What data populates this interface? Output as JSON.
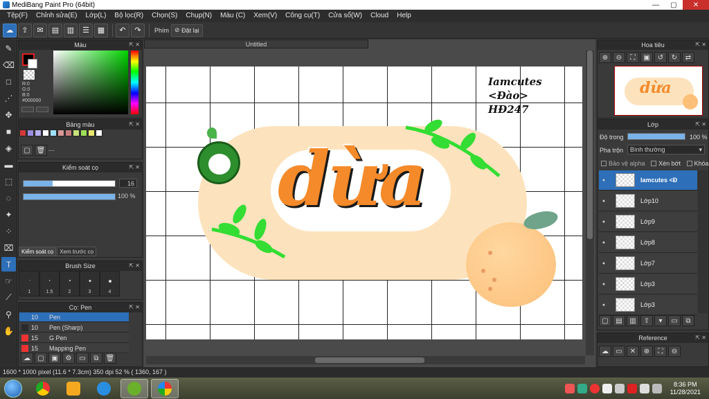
{
  "window": {
    "title": "MediBang Paint Pro (64bit)",
    "min": "—",
    "max": "▢",
    "close": "✕"
  },
  "menu": [
    "Tệp(F)",
    "Chỉnh sửa(E)",
    "Lớp(L)",
    "Bộ lọc(R)",
    "Chọn(S)",
    "Chụp(N)",
    "Màu (C)",
    "Xem(V)",
    "Công cụ(T)",
    "Cửa sổ(W)",
    "Cloud",
    "Help"
  ],
  "toolbar": {
    "shortcut_label": "Phím",
    "reset_label": "Đặt lại"
  },
  "panels": {
    "color": {
      "title": "Màu",
      "r": "R:0",
      "g": "G:0",
      "b": "B:0",
      "hex": "#000000"
    },
    "palette": {
      "title": "Bảng màu",
      "name_placeholder": "---",
      "swatches": [
        "#d23a3a",
        "#9b8ee0",
        "#b7b0f0",
        "#ffffff",
        "#a0e0ff",
        "#d89898",
        "#c67d7d",
        "#c8e27c",
        "#9ee05a",
        "#e8e870",
        "#ffffff"
      ]
    },
    "brush_control": {
      "title": "Kiểm soát cọ",
      "size_value": "16",
      "size_fraction": 0.32,
      "opacity_value": "100 %",
      "opacity_fraction": 1.0,
      "tabs": [
        "Kiểm soát cọ",
        "Xem trước cọ"
      ]
    },
    "brush_size": {
      "title": "Brush Size",
      "sizes": [
        "1",
        "1.5",
        "2",
        "3",
        "4"
      ]
    },
    "brushes": {
      "title": "Cọ: Pen",
      "items": [
        {
          "size": "10",
          "name": "Pen",
          "color": "#2d6fb8",
          "selected": true
        },
        {
          "size": "10",
          "name": "Pen (Sharp)",
          "color": "#2a2a2a",
          "selected": false
        },
        {
          "size": "15",
          "name": "G Pen",
          "color": "#e33",
          "selected": false
        },
        {
          "size": "15",
          "name": "Mapping Pen",
          "color": "#e33",
          "selected": false
        }
      ]
    },
    "navigator": {
      "title": "Hoa tiêu"
    },
    "layers": {
      "title": "Lớp",
      "opacity_label": "Độ trong",
      "opacity_value": "100 %",
      "opacity_fraction": 1.0,
      "blend_label": "Pha trộn",
      "blend_value": "Bình thường",
      "protect_alpha": "Bảo vệ alpha",
      "clipping": "Xén bớt",
      "lock": "Khóa",
      "items": [
        "Iamcutes <Đ",
        "Lớp10",
        "Lớp9",
        "Lớp8",
        "Lớp7",
        "Lớp3",
        "Lớp3"
      ]
    },
    "reference": {
      "title": "Reference"
    }
  },
  "document": {
    "tab": "Untitled",
    "credit_line1": "Iamcutes <Đào>",
    "credit_line2": "HĐ247",
    "word": "dừa"
  },
  "status": "1600 * 1000 pixel   (11.6 * 7.3cm)   350 dpi   52 %   ( 1360, 167 )",
  "taskbar": {
    "time": "8:36 PM",
    "date": "11/28/2021"
  },
  "colors": {
    "accent": "#2d6fb8",
    "orange": "#f48a2a",
    "peach": "#fde3bd",
    "leaf": "#33dd33"
  }
}
